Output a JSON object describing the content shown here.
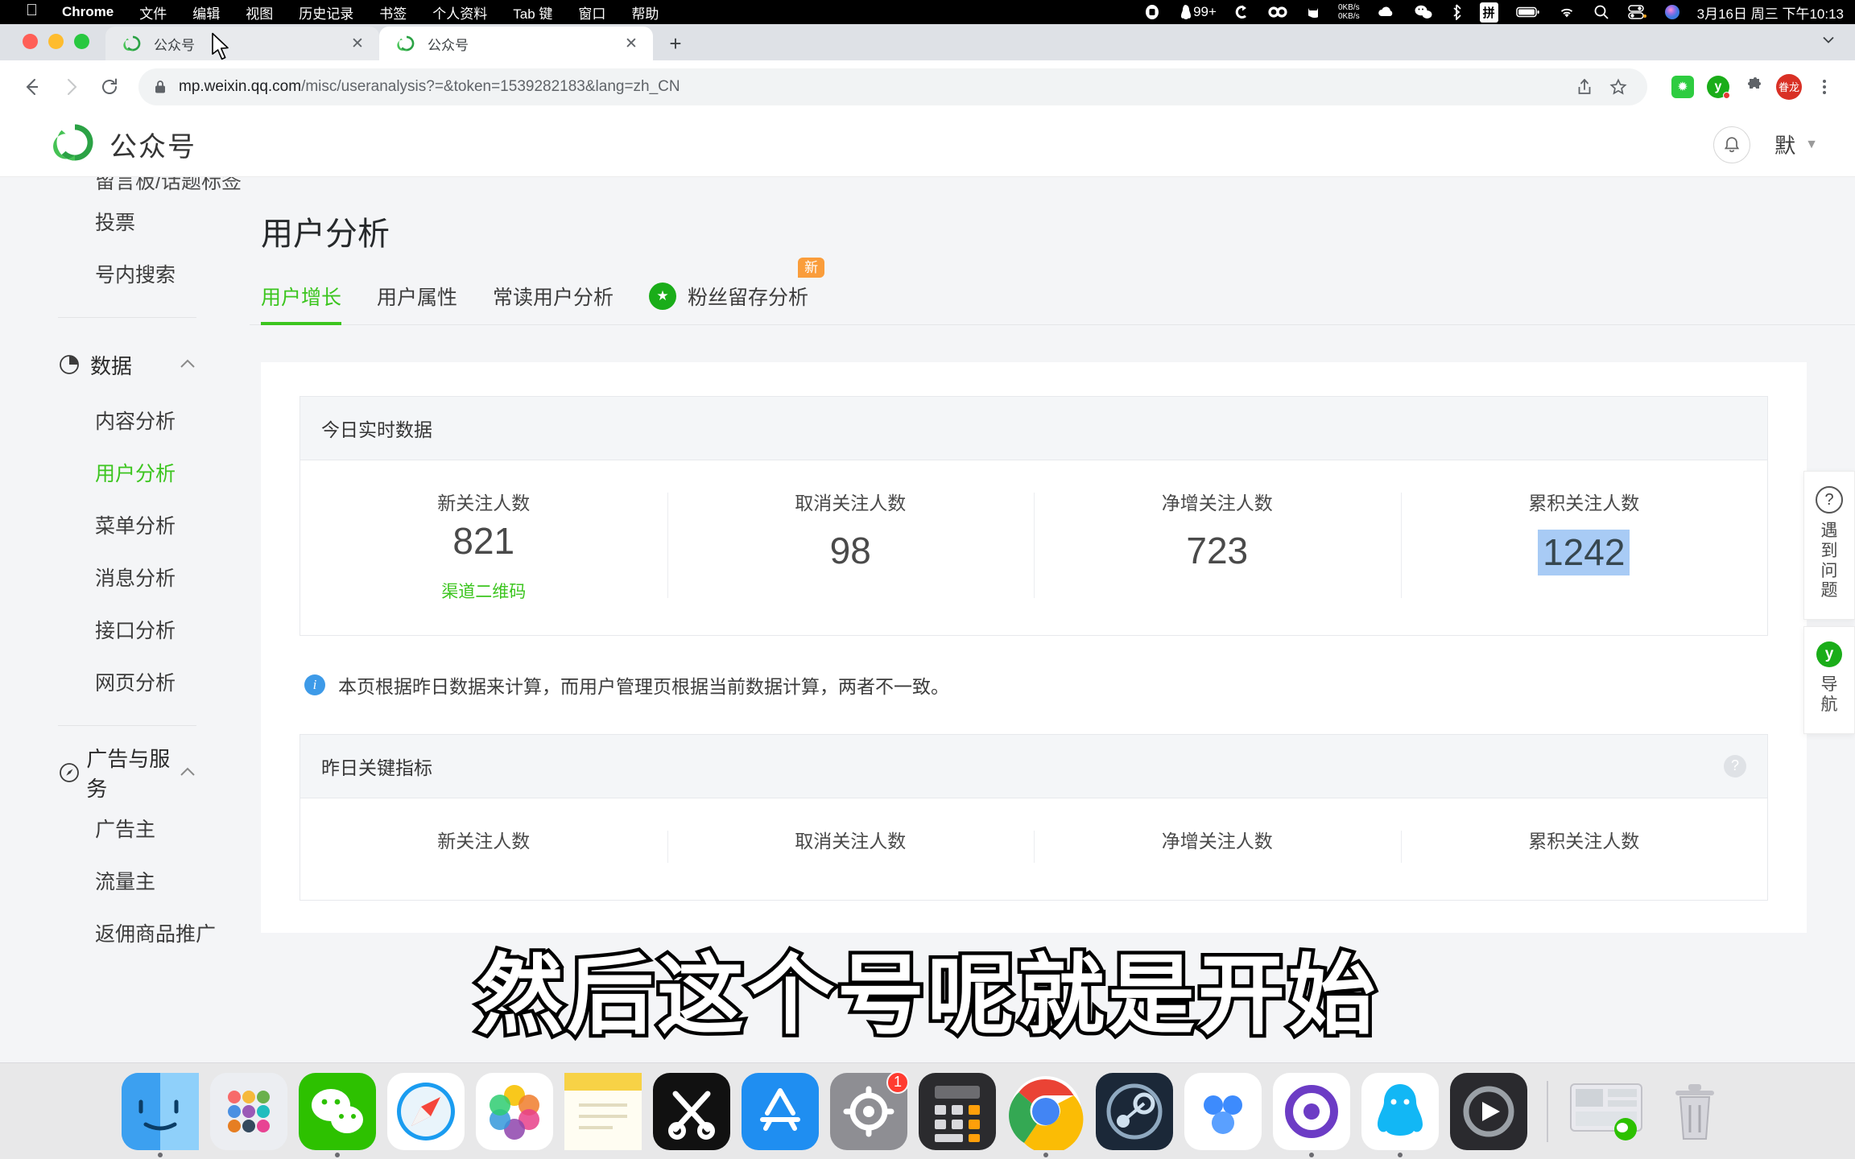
{
  "menubar": {
    "apple": "apple-logo",
    "items": [
      {
        "label": "Chrome",
        "bold": true
      },
      {
        "label": "文件"
      },
      {
        "label": "编辑"
      },
      {
        "label": "视图"
      },
      {
        "label": "历史记录"
      },
      {
        "label": "书签"
      },
      {
        "label": "个人资料"
      },
      {
        "label": "Tab 键"
      },
      {
        "label": "窗口"
      },
      {
        "label": "帮助"
      }
    ],
    "status": {
      "qq_badge": "99+",
      "network_up": "0KB/s",
      "network_down": "0KB/s",
      "input_method": "拼",
      "clock": "3月16日 周三 下午10:13"
    }
  },
  "browser": {
    "tabs": [
      {
        "title": "公众号",
        "active": false
      },
      {
        "title": "公众号",
        "active": true
      }
    ],
    "new_tab_label": "+",
    "close_label": "✕",
    "url_host": "mp.weixin.qq.com",
    "url_rest": "/misc/useranalysis?=&token=1539282183&lang=zh_CN",
    "extension_avatar": "眷龙",
    "ext_y": "y",
    "ext_chat": "✹"
  },
  "site": {
    "brand": "公众号",
    "account_name": "默"
  },
  "sidebar": {
    "clipped_item": "留言板/话题标签",
    "items": [
      {
        "label": "投票",
        "active": false
      },
      {
        "label": "号内搜索",
        "active": false
      }
    ],
    "groups": [
      {
        "label": "数据",
        "icon": "pie-chart-icon",
        "items": [
          {
            "label": "内容分析",
            "active": false
          },
          {
            "label": "用户分析",
            "active": true
          },
          {
            "label": "菜单分析",
            "active": false
          },
          {
            "label": "消息分析",
            "active": false
          },
          {
            "label": "接口分析",
            "active": false
          },
          {
            "label": "网页分析",
            "active": false
          }
        ]
      },
      {
        "label": "广告与服务",
        "icon": "compass-icon",
        "items": [
          {
            "label": "广告主",
            "active": false
          },
          {
            "label": "流量主",
            "active": false
          },
          {
            "label": "返佣商品推广",
            "active": false
          }
        ]
      }
    ]
  },
  "main": {
    "page_title": "用户分析",
    "tabs": [
      {
        "label": "用户增长",
        "active": true,
        "icon": null,
        "badge": null
      },
      {
        "label": "用户属性",
        "active": false,
        "icon": null,
        "badge": null
      },
      {
        "label": "常读用户分析",
        "active": false,
        "icon": null,
        "badge": null
      },
      {
        "label": "粉丝留存分析",
        "active": false,
        "icon": "retention-icon",
        "badge": "新"
      }
    ],
    "realtime": {
      "title": "今日实时数据",
      "stats": [
        {
          "label": "新关注人数",
          "value": "821",
          "link": "渠道二维码",
          "selected": false
        },
        {
          "label": "取消关注人数",
          "value": "98",
          "link": null,
          "selected": false
        },
        {
          "label": "净增关注人数",
          "value": "723",
          "link": null,
          "selected": false
        },
        {
          "label": "累积关注人数",
          "value": "1242",
          "link": null,
          "selected": true
        }
      ]
    },
    "notice": "本页根据昨日数据来计算，而用户管理页根据当前数据计算，两者不一致。",
    "yesterday": {
      "title": "昨日关键指标",
      "stats": [
        {
          "label": "新关注人数"
        },
        {
          "label": "取消关注人数"
        },
        {
          "label": "净增关注人数"
        },
        {
          "label": "累积关注人数"
        }
      ]
    }
  },
  "rail": {
    "help_label": "遇到问题",
    "nav_label": "导航",
    "help_icon": "question-mark-icon",
    "nav_icon": "youdao-icon"
  },
  "caption": "然后这个号呢就是开始",
  "dock": {
    "items": [
      {
        "name": "finder",
        "glyph": "☺",
        "bg": "#3ca0f0",
        "running": true,
        "badge": null
      },
      {
        "name": "launchpad",
        "glyph": "⠿",
        "bg": "#e8e8ed",
        "running": false,
        "badge": null
      },
      {
        "name": "wechat",
        "glyph": "✹",
        "bg": "#2dc100",
        "running": true,
        "badge": null
      },
      {
        "name": "safari",
        "glyph": "◎",
        "bg": "#2196f3",
        "running": false,
        "badge": null
      },
      {
        "name": "photos",
        "glyph": "❀",
        "bg": "#ffffff",
        "running": false,
        "badge": null
      },
      {
        "name": "notes",
        "glyph": "▤",
        "bg": "#ffd83d",
        "running": false,
        "badge": null
      },
      {
        "name": "capcut",
        "glyph": "✂",
        "bg": "#1a1a1a",
        "running": false,
        "badge": null
      },
      {
        "name": "app-store",
        "glyph": "A",
        "bg": "#1f8ef1",
        "running": false,
        "badge": null
      },
      {
        "name": "system-settings",
        "glyph": "⚙",
        "bg": "#8e8e93",
        "running": false,
        "badge": "1"
      },
      {
        "name": "calculator",
        "glyph": "▦",
        "bg": "#2b2b2e",
        "running": false,
        "badge": null
      },
      {
        "name": "chrome",
        "glyph": "◉",
        "bg": "#ffffff",
        "running": true,
        "badge": null
      },
      {
        "name": "steam",
        "glyph": "◈",
        "bg": "#1b2838",
        "running": false,
        "badge": null
      },
      {
        "name": "baidu-netdisk",
        "glyph": "☁",
        "bg": "#3d8bfd",
        "running": false,
        "badge": null
      },
      {
        "name": "circle-app",
        "glyph": "◯",
        "bg": "#6c3cc5",
        "running": true,
        "badge": null
      },
      {
        "name": "qq",
        "glyph": "Q",
        "bg": "#12b7f5",
        "running": true,
        "badge": null
      },
      {
        "name": "quicktime",
        "glyph": "▷",
        "bg": "#2a2a2e",
        "running": false,
        "badge": null
      }
    ],
    "recent": {
      "name": "recent-window",
      "glyph": "▣",
      "bg": "#e4e4e8"
    },
    "trash": {
      "name": "trash",
      "glyph": "🗑",
      "bg": "#d8d8de"
    }
  }
}
